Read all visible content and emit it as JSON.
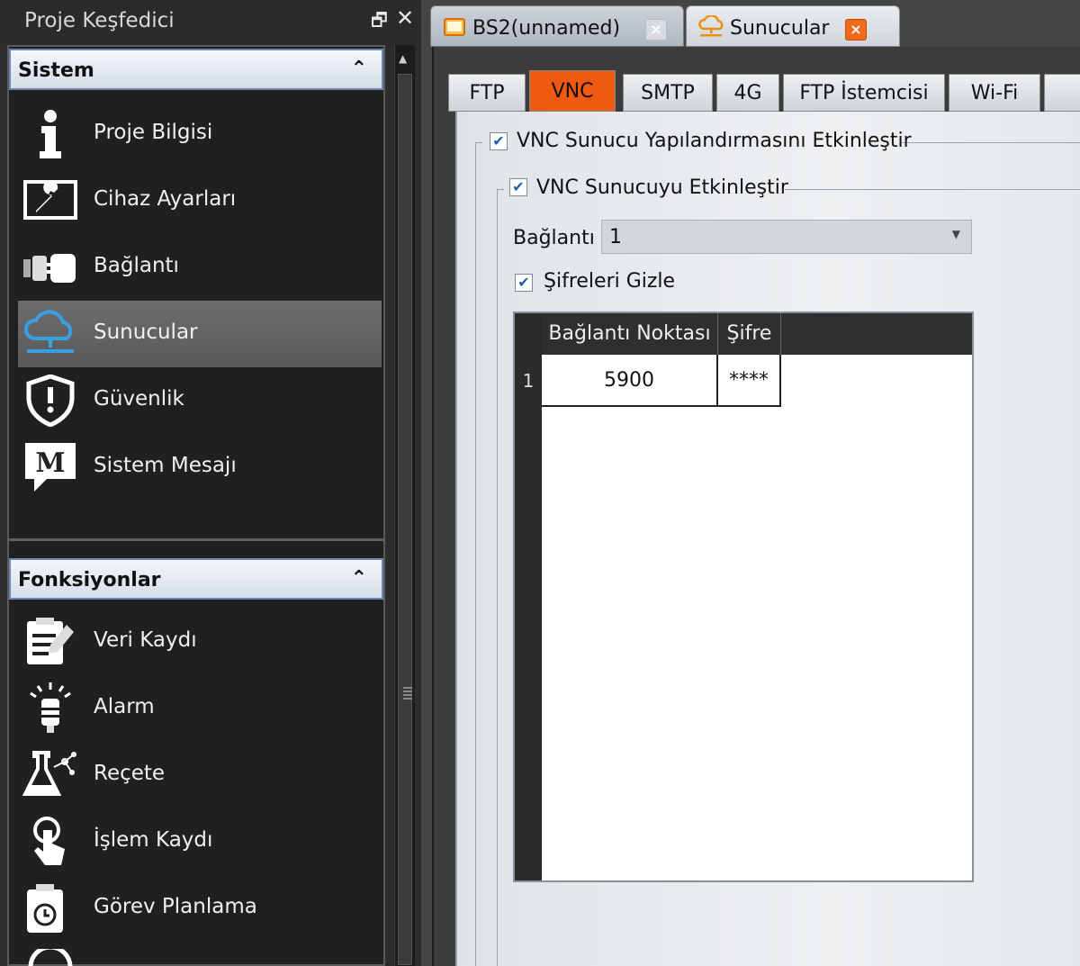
{
  "explorer": {
    "title": "Proje Keşfedici",
    "pin_icon": "pin-icon",
    "close_icon": "close-icon",
    "groups": [
      {
        "label": "Sistem",
        "items": [
          {
            "label": "Proje Bilgisi",
            "icon": "info-icon"
          },
          {
            "label": "Cihaz Ayarları",
            "icon": "wrench-icon"
          },
          {
            "label": "Bağlantı",
            "icon": "plug-icon"
          },
          {
            "label": "Sunucular",
            "icon": "cloud-icon"
          },
          {
            "label": "Güvenlik",
            "icon": "shield-icon"
          },
          {
            "label": "Sistem Mesajı",
            "icon": "message-icon"
          }
        ],
        "active_item": "Sunucular"
      },
      {
        "label": "Fonksiyonlar",
        "items": [
          {
            "label": "Veri Kaydı",
            "icon": "clipboard-icon"
          },
          {
            "label": "Alarm",
            "icon": "alarm-icon"
          },
          {
            "label": "Reçete",
            "icon": "flask-icon"
          },
          {
            "label": "İşlem Kaydı",
            "icon": "hand-pointer-icon"
          },
          {
            "label": "Görev Planlama",
            "icon": "scheduler-icon"
          }
        ]
      }
    ]
  },
  "doc_tabs": [
    {
      "label": "BS2(unnamed)",
      "close": "×"
    },
    {
      "label": "Sunucular",
      "close": "×"
    }
  ],
  "config_tabs": [
    "FTP",
    "VNC",
    "SMTP",
    "4G",
    "FTP İstemcisi",
    "Wi-Fi"
  ],
  "active_config_tab": "VNC",
  "vnc": {
    "enable_config_label": "VNC Sunucu Yapılandırmasını Etkinleştir",
    "enable_config_checked": true,
    "enable_server_label": "VNC Sunucuyu Etkinleştir",
    "enable_server_checked": true,
    "connection_label": "Bağlantı",
    "connection_value": "1",
    "hide_passwords_label": "Şifreleri Gizle",
    "hide_passwords_checked": true,
    "table": {
      "columns": [
        "Bağlantı Noktası",
        "Şifre"
      ],
      "rows": [
        {
          "num": "1",
          "port": "5900",
          "password": "****"
        }
      ]
    }
  },
  "colors": {
    "active_tab": "#f05a10",
    "sidebar_bg": "#202020",
    "group_header_border": "#6c86b5"
  }
}
